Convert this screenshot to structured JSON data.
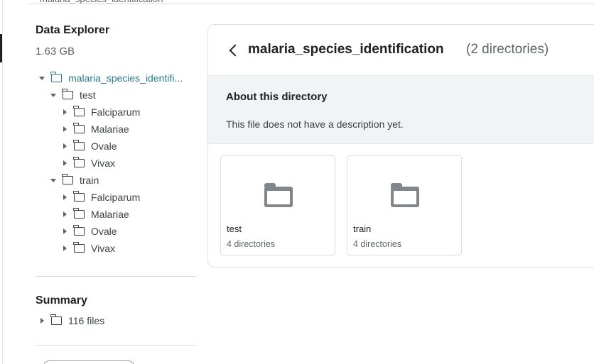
{
  "top_strip": {
    "text": "malaria_species_identification"
  },
  "sidebar": {
    "title": "Data Explorer",
    "size": "1.63 GB",
    "tree": [
      {
        "label": "malaria_species_identifi...",
        "depth": 0,
        "expanded": true,
        "root": true
      },
      {
        "label": "test",
        "depth": 1,
        "expanded": true
      },
      {
        "label": "Falciparum",
        "depth": 2,
        "expanded": false
      },
      {
        "label": "Malariae",
        "depth": 2,
        "expanded": false
      },
      {
        "label": "Ovale",
        "depth": 2,
        "expanded": false
      },
      {
        "label": "Vivax",
        "depth": 2,
        "expanded": false
      },
      {
        "label": "train",
        "depth": 1,
        "expanded": true
      },
      {
        "label": "Falciparum",
        "depth": 2,
        "expanded": false
      },
      {
        "label": "Malariae",
        "depth": 2,
        "expanded": false
      },
      {
        "label": "Ovale",
        "depth": 2,
        "expanded": false
      },
      {
        "label": "Vivax",
        "depth": 2,
        "expanded": false
      }
    ],
    "summary": {
      "title": "Summary",
      "item": {
        "label": "116 files",
        "expanded": false
      }
    }
  },
  "main": {
    "title": "malaria_species_identification",
    "count": "(2 directories)",
    "about": {
      "title": "About this directory",
      "description": "This file does not have a description yet."
    },
    "cards": [
      {
        "name": "test",
        "meta": "4 directories"
      },
      {
        "name": "train",
        "meta": "4 directories"
      }
    ]
  },
  "icons": {
    "folder": "folder-icon",
    "back": "chevron-left-icon",
    "expand": "caret-down-icon",
    "collapse": "caret-right-icon"
  },
  "colors": {
    "root_link": "#2a7a8c",
    "about_bg": "#f1f3f4",
    "folder_fill": "#80868b"
  }
}
